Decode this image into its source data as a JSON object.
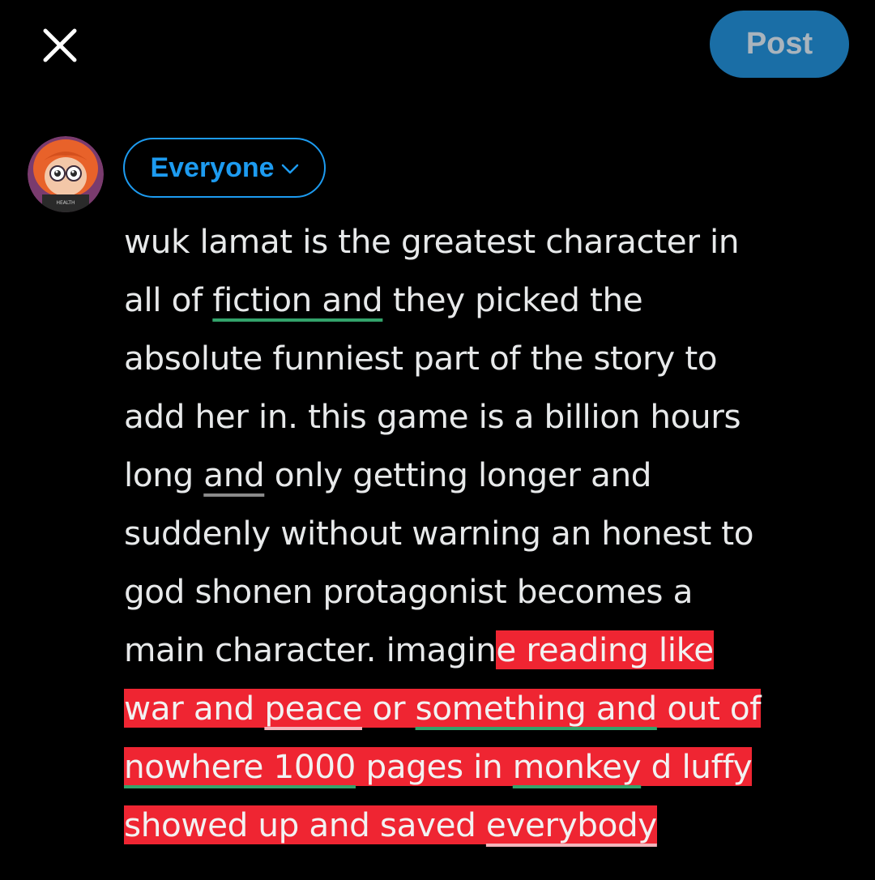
{
  "header": {
    "close_icon": "close-icon",
    "post_label": "Post"
  },
  "colors": {
    "background": "#000000",
    "accent": "#1d9bf0",
    "post_button_bg": "#1a6ea6",
    "post_button_text": "#a9b4bd",
    "highlight": "#ef2532",
    "underline_green": "#33a36b"
  },
  "composer": {
    "avatar_icon": "user-avatar",
    "avatar_badge_text": "HEALTH",
    "audience_label": "Everyone",
    "audience_icon": "chevron-down-icon",
    "text": {
      "l1": "wuk lamat is the greatest character in",
      "l2a": "all of ",
      "l2b": "fiction and",
      "l2c": " they picked the",
      "l3": "absolute funniest part of the story to",
      "l4": "add her in. this game is a billion hours",
      "l5a": "long ",
      "l5b": "and",
      "l5c": " only getting longer and",
      "l6": "suddenly without warning an honest to",
      "l7": "god shonen protagonist becomes a",
      "l8a": "main character. imagin",
      "l8b": "e reading like",
      "l9a": "war and ",
      "l9b": "peace",
      "l9c": " or ",
      "l9d": "something and",
      "l9e": " out of",
      "l10a": "nowhere 1000",
      "l10b": " pages in ",
      "l10c": "monkey",
      "l10d": " d luffy",
      "l11a": "showed up and saved ",
      "l11b": "everybody"
    }
  }
}
